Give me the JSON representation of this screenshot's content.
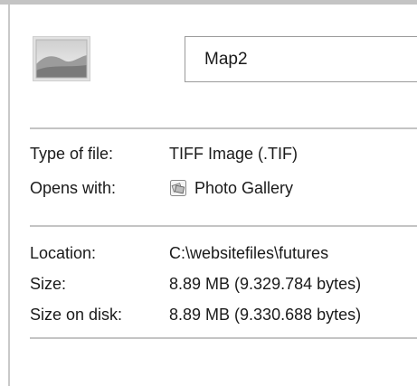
{
  "file": {
    "name": "Map2",
    "thumbnail_icon": "image-thumbnail-icon"
  },
  "type_section": {
    "type_label": "Type of file:",
    "type_value": "TIFF Image (.TIF)",
    "opens_label": "Opens with:",
    "opens_value": "Photo Gallery",
    "opens_icon": "photo-gallery-icon"
  },
  "location_section": {
    "location_label": "Location:",
    "location_value": "C:\\websitefiles\\futures",
    "size_label": "Size:",
    "size_value": "8.89 MB (9.329.784 bytes)",
    "size_on_disk_label": "Size on disk:",
    "size_on_disk_value": "8.89 MB (9.330.688 bytes)"
  }
}
